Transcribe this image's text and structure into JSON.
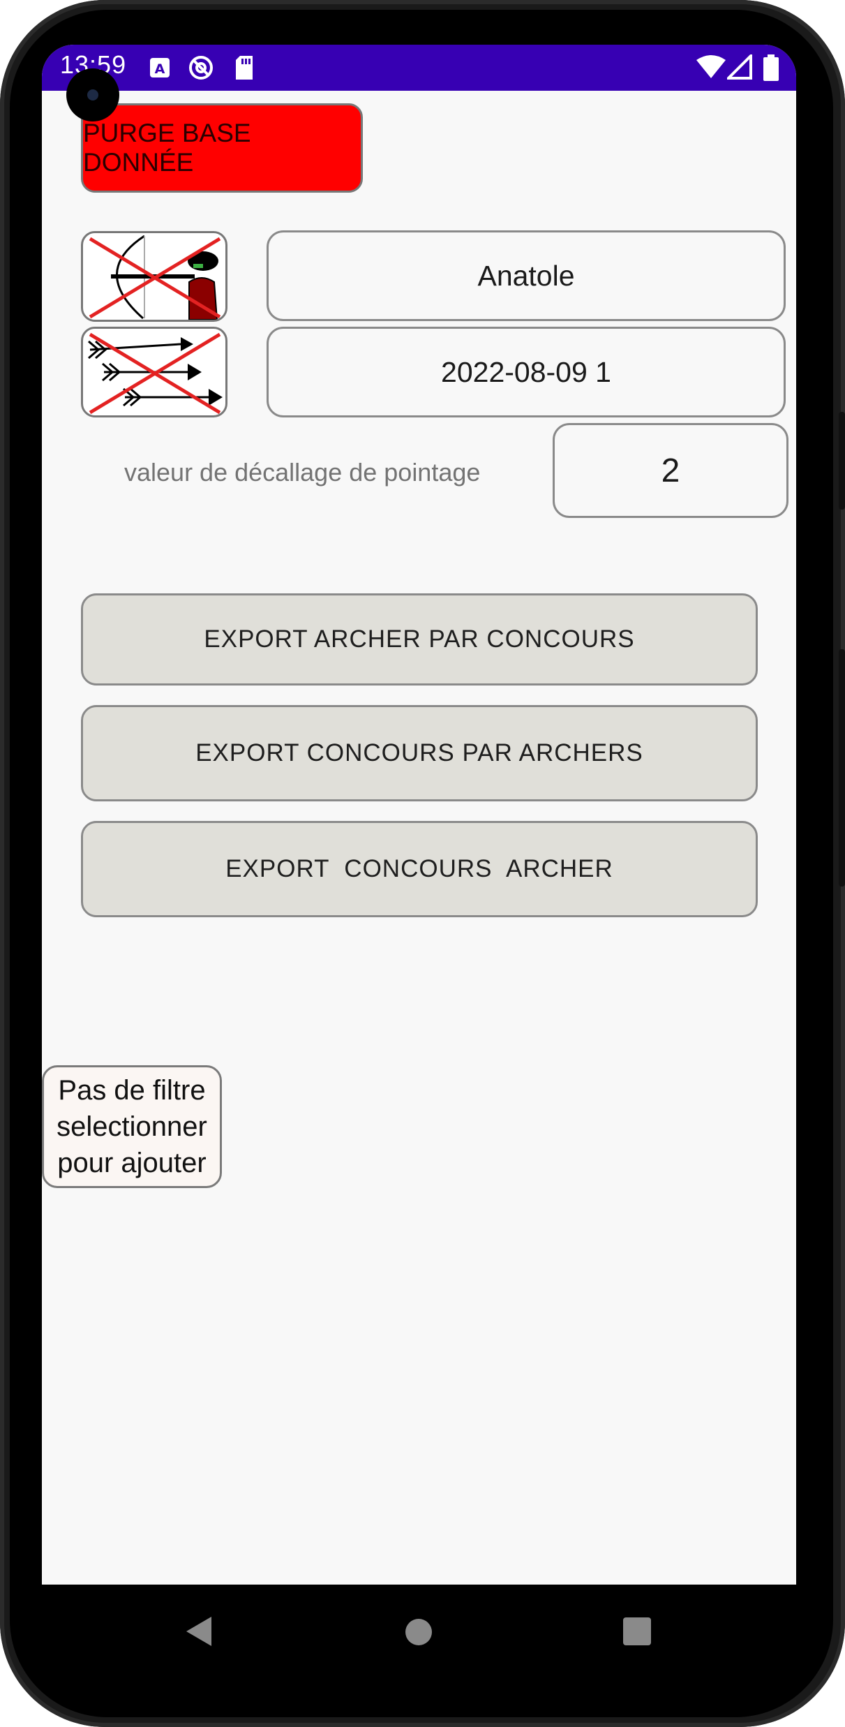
{
  "status_bar": {
    "time": "13:59",
    "left_icons": [
      "a-icon",
      "at-circle-icon",
      "sd-card-icon"
    ],
    "right_icons": [
      "wifi-icon",
      "signal-icon",
      "battery-icon"
    ],
    "color": "#3700b3"
  },
  "purge_button": {
    "label": "PURGE BASE DONNÉE",
    "color": "#ff0000"
  },
  "archer_field": {
    "value": "Anatole"
  },
  "concours_field": {
    "value": "2022-08-09 1"
  },
  "offset": {
    "label": "valeur de décallage de pointage",
    "value": "2"
  },
  "exports": [
    {
      "label": "EXPORT ARCHER PAR CONCOURS"
    },
    {
      "label": "EXPORT CONCOURS PAR ARCHERS"
    },
    {
      "label": "EXPORT  CONCOURS  ARCHER"
    }
  ],
  "filter_button": {
    "line1": "Pas de filtre",
    "line2": "selectionner",
    "line3": "pour ajouter"
  },
  "nav_bar": {
    "icons": [
      "back-icon",
      "home-icon",
      "recents-icon"
    ]
  }
}
